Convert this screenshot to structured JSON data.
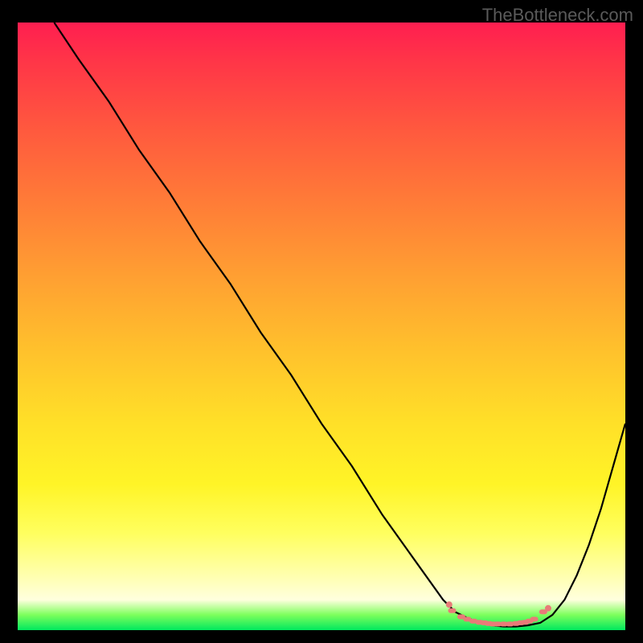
{
  "attribution": "TheBottleneck.com",
  "chart_data": {
    "type": "line",
    "title": "",
    "xlabel": "",
    "ylabel": "",
    "xlim": [
      0,
      100
    ],
    "ylim": [
      0,
      100
    ],
    "series": [
      {
        "name": "bottleneck-curve",
        "x": [
          6,
          10,
          15,
          20,
          25,
          30,
          35,
          40,
          45,
          50,
          55,
          60,
          65,
          70,
          72,
          74,
          76,
          78,
          80,
          82,
          84,
          86,
          88,
          90,
          92,
          94,
          96,
          98,
          100
        ],
        "y": [
          100,
          94,
          87,
          79,
          72,
          64,
          57,
          49,
          42,
          34,
          27,
          19,
          12,
          5,
          3,
          2,
          1.2,
          0.8,
          0.6,
          0.6,
          0.8,
          1.2,
          2.5,
          5,
          9,
          14,
          20,
          27,
          34
        ]
      }
    ],
    "markers": {
      "name": "optimal-zone",
      "x": [
        71.5,
        73,
        74,
        75,
        76,
        76.8,
        77.5,
        78.2,
        79,
        80,
        81,
        82,
        82.8,
        83.5,
        84.2,
        85,
        86.5
      ],
      "y": [
        3.2,
        2.2,
        1.8,
        1.5,
        1.3,
        1.2,
        1.1,
        1.0,
        1.0,
        1.0,
        1.0,
        1.1,
        1.2,
        1.3,
        1.5,
        1.8,
        3.0
      ]
    },
    "background": {
      "type": "vertical-gradient",
      "stops": [
        {
          "pos": 0,
          "color": "#ff1e50"
        },
        {
          "pos": 50,
          "color": "#ffb030"
        },
        {
          "pos": 85,
          "color": "#ffff60"
        },
        {
          "pos": 100,
          "color": "#00e85e"
        }
      ]
    }
  }
}
